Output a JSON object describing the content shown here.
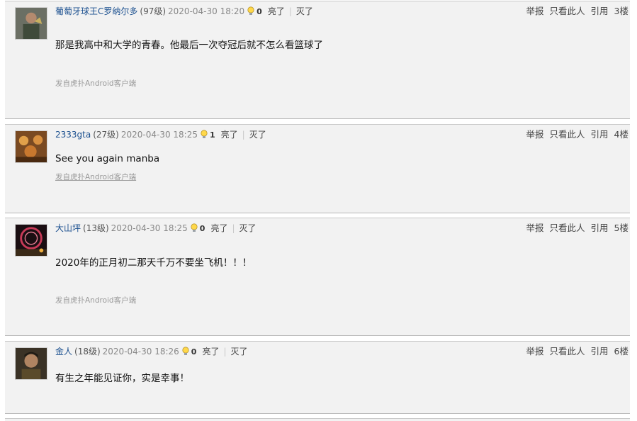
{
  "actions": {
    "like": "亮了",
    "dislike": "灭了",
    "report": "举报",
    "only_this": "只看此人",
    "quote": "引用"
  },
  "source_text": "发自虎扑Android客户端",
  "posts": [
    {
      "user": "葡萄牙球王C罗纳尔多",
      "level": "(97级)",
      "time": "2020-04-30 18:20",
      "likes": "0",
      "content": "那是我高中和大学的青春。他最后一次夺冠后就不怎么看篮球了",
      "floor": "3楼"
    },
    {
      "user": "2333gta",
      "level": "(27级)",
      "time": "2020-04-30 18:25",
      "likes": "1",
      "content": "See you again manba",
      "floor": "4楼"
    },
    {
      "user": "大山坪",
      "level": "(13级)",
      "time": "2020-04-30 18:25",
      "likes": "0",
      "content": "2020年的正月初二那天千万不要坐飞机！！！",
      "floor": "5楼"
    },
    {
      "user": "金人",
      "level": "(18级)",
      "time": "2020-04-30 18:26",
      "likes": "0",
      "content": "有生之年能见证你，实是幸事！",
      "floor": "6楼"
    }
  ]
}
